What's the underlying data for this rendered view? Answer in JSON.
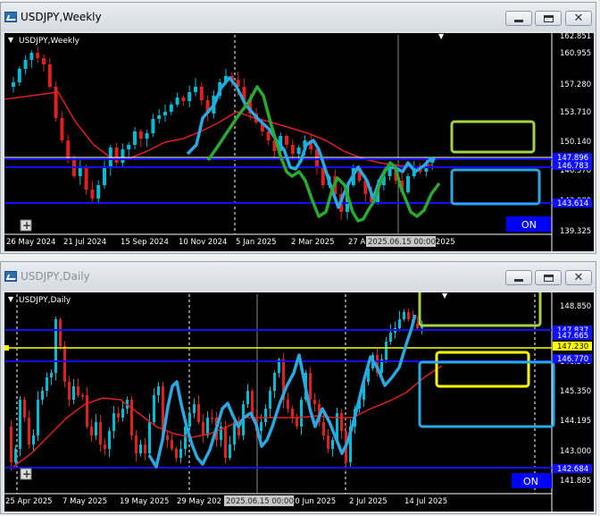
{
  "colors": {
    "background": "#000000",
    "bull_candle": "#00bcd4",
    "bear_candle": "#e02020",
    "ma_line": "#e02020",
    "grid_line": "#ffffff",
    "level_blue": "#1010ff",
    "level_yellow": "#ffff00",
    "draw_cyan": "#2aa8e0",
    "draw_green": "#2aa830",
    "box_lime": "#a6d14a",
    "button_blue": "#0000ff"
  },
  "weekly": {
    "title": "USDJPY,Weekly",
    "chart_label": "USDJPY,Weekly",
    "price_labels": [
      "162.851",
      "160.955",
      "157.280",
      "153.710",
      "150.140",
      "146.570",
      "143.000",
      "139.325"
    ],
    "marker_prices": [
      "147.896",
      "146.783",
      "143.614"
    ],
    "date_labels": [
      "26 May 2024",
      "21 Jul 2024",
      "15 Sep 2024",
      "10 Nov 2024",
      "5 Jan 2025",
      "2 Mar 2025",
      "27 A",
      "2025"
    ],
    "crosshair_time": "2025.06.15 00:00",
    "on_button": "ON",
    "plus_icon": "plus-icon"
  },
  "daily": {
    "title": "USDJPY,Daily",
    "chart_label": "USDJPY,Daily",
    "price_labels": [
      "148.850",
      "147.750",
      "146.540",
      "145.350",
      "144.195",
      "143.000",
      "141.885"
    ],
    "marker_prices": [
      "147.837",
      "147.665",
      "147.230",
      "146.770",
      "142.684"
    ],
    "date_labels": [
      "25 Apr 2025",
      "7 May 2025",
      "19 May 2025",
      "29 May 202",
      "20 Jun 2025",
      "2 Jul 2025",
      "14 Jul 2025"
    ],
    "crosshair_time": "2025.06.15 00:00",
    "on_button": "ON",
    "plus_icon": "plus-icon"
  },
  "window_buttons": {
    "minimize": "minimize-icon",
    "maximize": "maximize-icon",
    "close": "close-icon",
    "close_glyph": "✕"
  }
}
